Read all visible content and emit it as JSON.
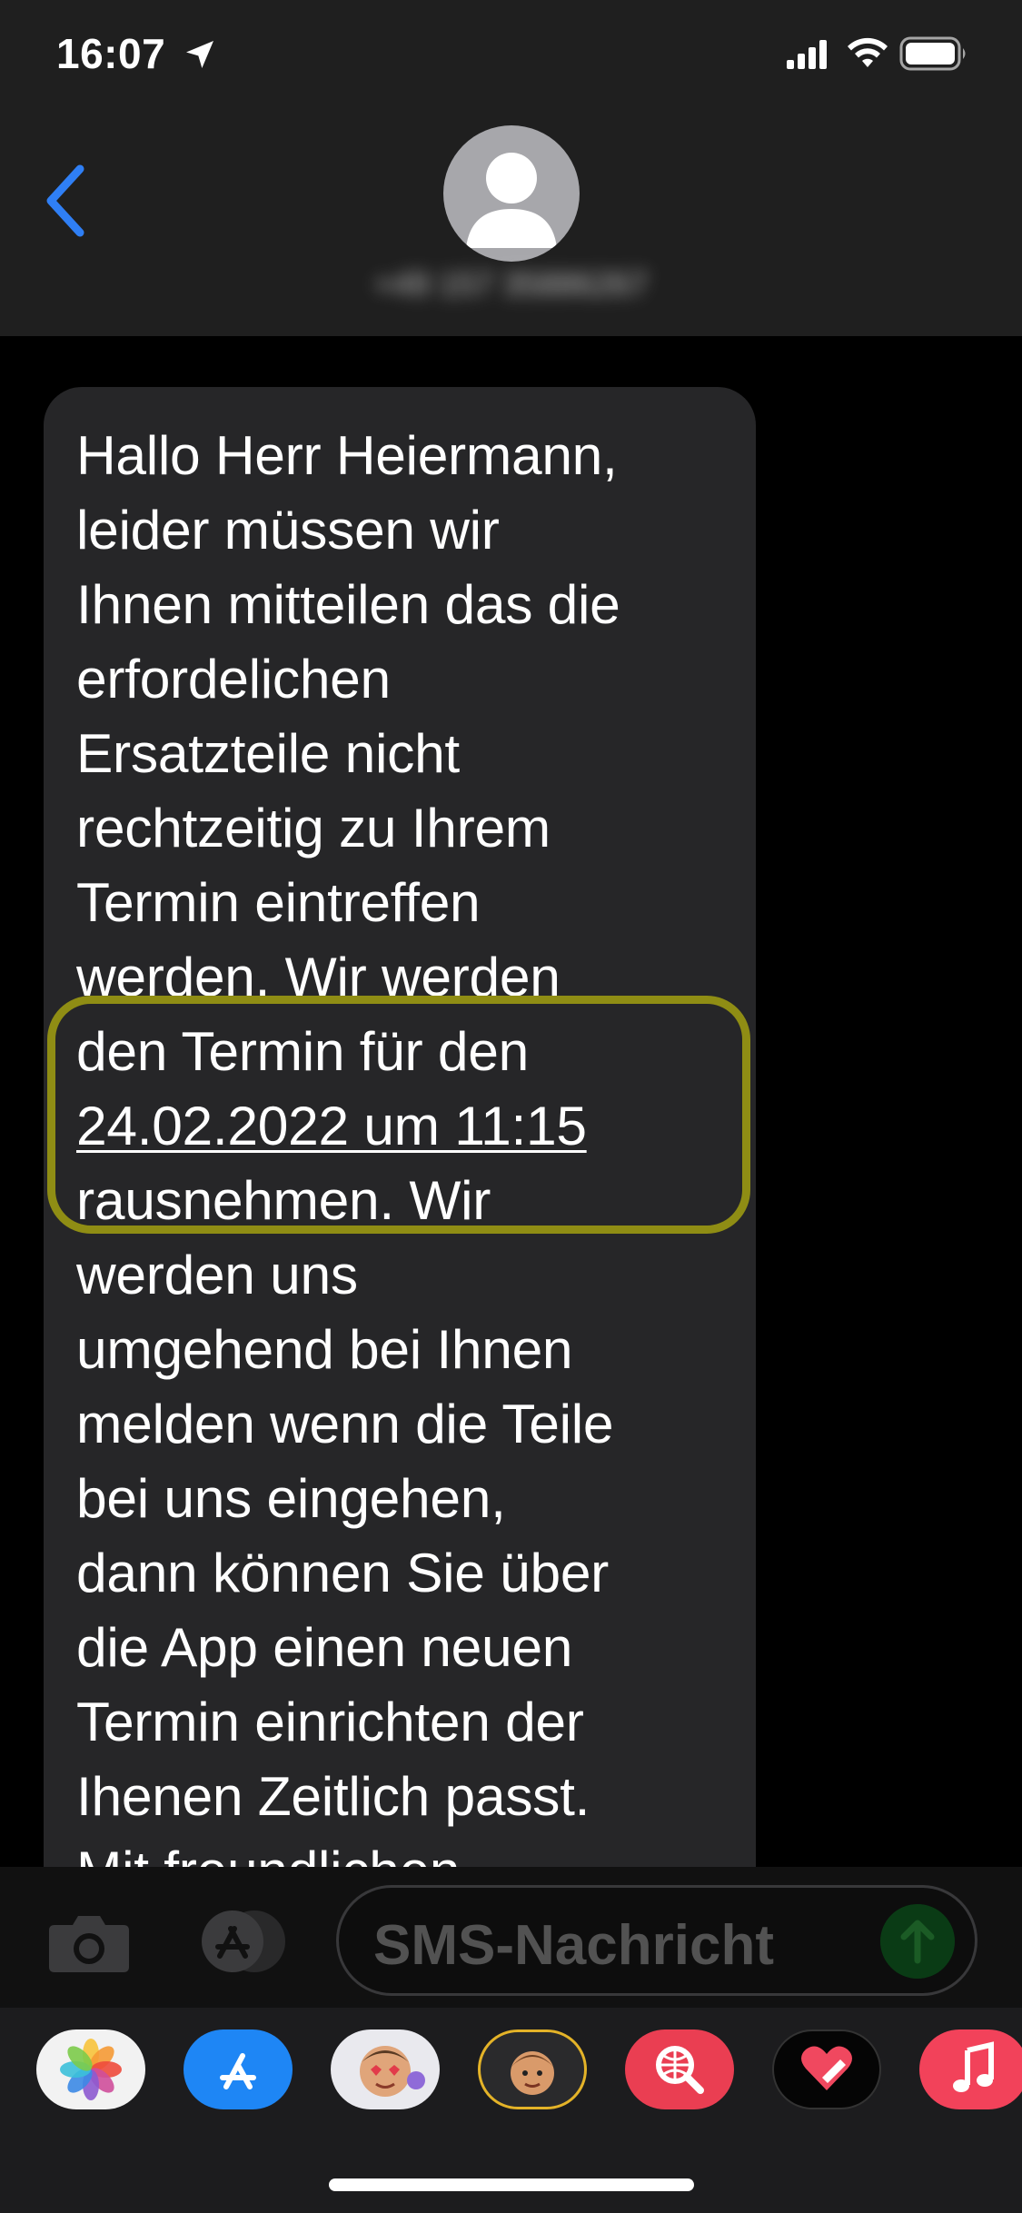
{
  "status_bar": {
    "time": "16:07"
  },
  "header": {
    "contact": "+49 157 35886267"
  },
  "message": {
    "text_before": "Hallo Herr Heiermann,\nleider müssen wir\nIhnen mitteilen das die\nerfordelichen\nErsatzteile nicht\nrechtzeitig zu Ihrem\nTermin eintreffen\nwerden. Wir werden\nden Termin für den\n",
    "date_link": "24.02.2022 um 11:15",
    "text_after": "\nrausnehmen. Wir\nwerden uns\numgehend bei Ihnen\nmelden wenn die Teile\nbei uns eingehen,\ndann können Sie über\ndie App einen neuen\nTermin einrichten der\nIhenen Zeitlich passt.\nMit freundlichen"
  },
  "input": {
    "placeholder": "SMS-Nachricht"
  },
  "app_drawer": {
    "apps": [
      "photos-icon",
      "app-store-icon",
      "memoji-stickers-icon",
      "memoji-icon",
      "web-search-icon",
      "heart-digital-touch-icon",
      "music-icon"
    ]
  },
  "colors": {
    "highlight": "#8f8d14",
    "accent_blue": "#2f7ff5",
    "bubble": "#262628"
  }
}
